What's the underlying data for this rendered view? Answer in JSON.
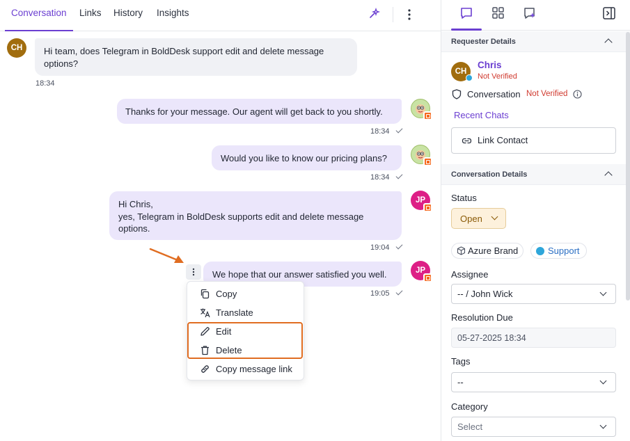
{
  "tabs": [
    {
      "label": "Conversation",
      "active": true
    },
    {
      "label": "Links"
    },
    {
      "label": "History"
    },
    {
      "label": "Insights"
    }
  ],
  "tab_tools": {
    "ai_icon": "sparkle-icon",
    "more_icon": "kebab-icon"
  },
  "messages": [
    {
      "avatar": "CH",
      "direction": "incoming",
      "lines": [
        "Hi team, does Telegram in BoldDesk support edit and delete message",
        "options?"
      ],
      "time": "18:34"
    },
    {
      "avatar": "bot",
      "direction": "outgoing",
      "lines": [
        "Thanks for your message. Our agent will get back to you shortly."
      ],
      "time": "18:34"
    },
    {
      "avatar": "bot",
      "direction": "outgoing",
      "lines": [
        "Would you like to know our pricing plans?"
      ],
      "time": "18:34"
    },
    {
      "avatar": "JP",
      "direction": "outgoing",
      "lines": [
        "Hi Chris,",
        "yes, Telegram in BoldDesk supports edit and delete message",
        "options."
      ],
      "time": "19:04"
    },
    {
      "avatar": "JP",
      "direction": "outgoing",
      "lines": [
        "We hope that our answer satisfied you well."
      ],
      "time": "19:05"
    }
  ],
  "context_menu": [
    {
      "label": "Copy",
      "icon": "copy-icon"
    },
    {
      "label": "Translate",
      "icon": "translate-icon"
    },
    {
      "label": "Edit",
      "icon": "pencil-icon"
    },
    {
      "label": "Delete",
      "icon": "trash-icon"
    },
    {
      "label": "Copy message link",
      "icon": "link-icon"
    }
  ],
  "right_panel": {
    "top_icons": [
      "chat-icon",
      "grid-icon",
      "ai-chat-icon",
      "collapse-panel-icon"
    ],
    "requester": {
      "section_title": "Requester Details",
      "avatar": "CH",
      "name": "Chris",
      "status": "Not Verified",
      "conversation_label": "Conversation",
      "conversation_status": "Not Verified",
      "recent_chats": "Recent Chats",
      "link_contact": "Link Contact"
    },
    "conversation": {
      "section_title": "Conversation Details",
      "status_label": "Status",
      "status_value": "Open",
      "brand_tag": "Azure Brand",
      "channel_tag": "Support",
      "assignee_label": "Assignee",
      "assignee_value": "-- / John Wick",
      "resolution_label": "Resolution Due",
      "resolution_value": "05-27-2025 18:34",
      "tags_label": "Tags",
      "tags_value": "--",
      "category_label": "Category",
      "category_placeholder": "Select"
    }
  },
  "colors": {
    "accent": "#6b3fd1",
    "highlight": "#e06d21",
    "not_verified": "#d03a2f",
    "status_bg": "#fdf1dc",
    "telegram": "#2ea6da"
  }
}
